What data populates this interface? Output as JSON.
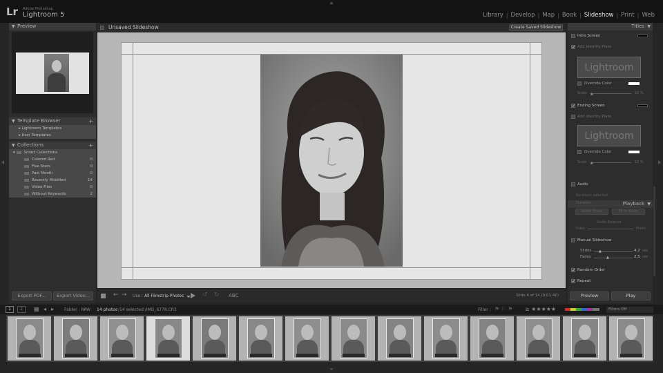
{
  "app": {
    "brand_small": "Adobe Photoshop",
    "brand_name": "Lightroom 5",
    "logo": "Lr"
  },
  "modules": [
    "Library",
    "Develop",
    "Map",
    "Book",
    "Slideshow",
    "Print",
    "Web"
  ],
  "active_module": "Slideshow",
  "left_panel": {
    "preview_title": "Preview",
    "template_browser": {
      "title": "Template Browser",
      "items": [
        "Lightroom Templates",
        "User Templates"
      ]
    },
    "collections": {
      "title": "Collections",
      "group": "Smart Collections",
      "items": [
        {
          "name": "Colored Red",
          "count": "0"
        },
        {
          "name": "Five Stars",
          "count": "0"
        },
        {
          "name": "Past Month",
          "count": "0"
        },
        {
          "name": "Recently Modified",
          "count": "14"
        },
        {
          "name": "Video Files",
          "count": "0"
        },
        {
          "name": "Without Keywords",
          "count": "2"
        }
      ]
    },
    "export_pdf": "Export PDF...",
    "export_video": "Export Video..."
  },
  "center": {
    "slideshow_name": "Unsaved Slideshow",
    "create_saved": "Create Saved Slideshow",
    "toolbar": {
      "use_label": "Use:",
      "use_value": "All Filmstrip Photos",
      "abc": "ABC",
      "slide_status": "Slide 4 of 14 (0:01:40)"
    }
  },
  "right_panel": {
    "titles_header": "Titles",
    "intro_screen": "Intro Screen",
    "add_identity_plate": "Add Identity Plate",
    "plate_text": "Lightroom",
    "override_color": "Override Color",
    "scale_label": "Scale",
    "scale_value": "10 %",
    "ending_screen": "Ending Screen",
    "playback_header": "Playback",
    "audio": "Audio",
    "no_music": "No music selected",
    "duration": "Duration:",
    "select_music": "Select Music",
    "fit_to_music": "Fit to Music",
    "audio_balance": "Audio Balance",
    "video_label": "Video",
    "music_label": "Music",
    "manual_slideshow": "Manual Slideshow",
    "slides_label": "Slides",
    "slides_value": "4,2",
    "slides_unit": "sec",
    "fades_label": "Fades",
    "fades_value": "2,5",
    "fades_unit": "sec",
    "random_order": "Random Order",
    "repeat": "Repeat",
    "preview_btn": "Preview",
    "play_btn": "Play",
    "colors": {
      "intro_swatch": "#000000",
      "override_swatch": "#ffffff",
      "ending_swatch": "#000000"
    }
  },
  "filmstrip": {
    "page1": "1",
    "page2": "2",
    "folder": "Folder : RAW",
    "count": "14 photos",
    "selection": "/14 selected /IMG_6778.CR2",
    "filter_label": "Filter :",
    "filters_off": "Filters Off",
    "selected_index": 3,
    "thumbs": 14
  }
}
